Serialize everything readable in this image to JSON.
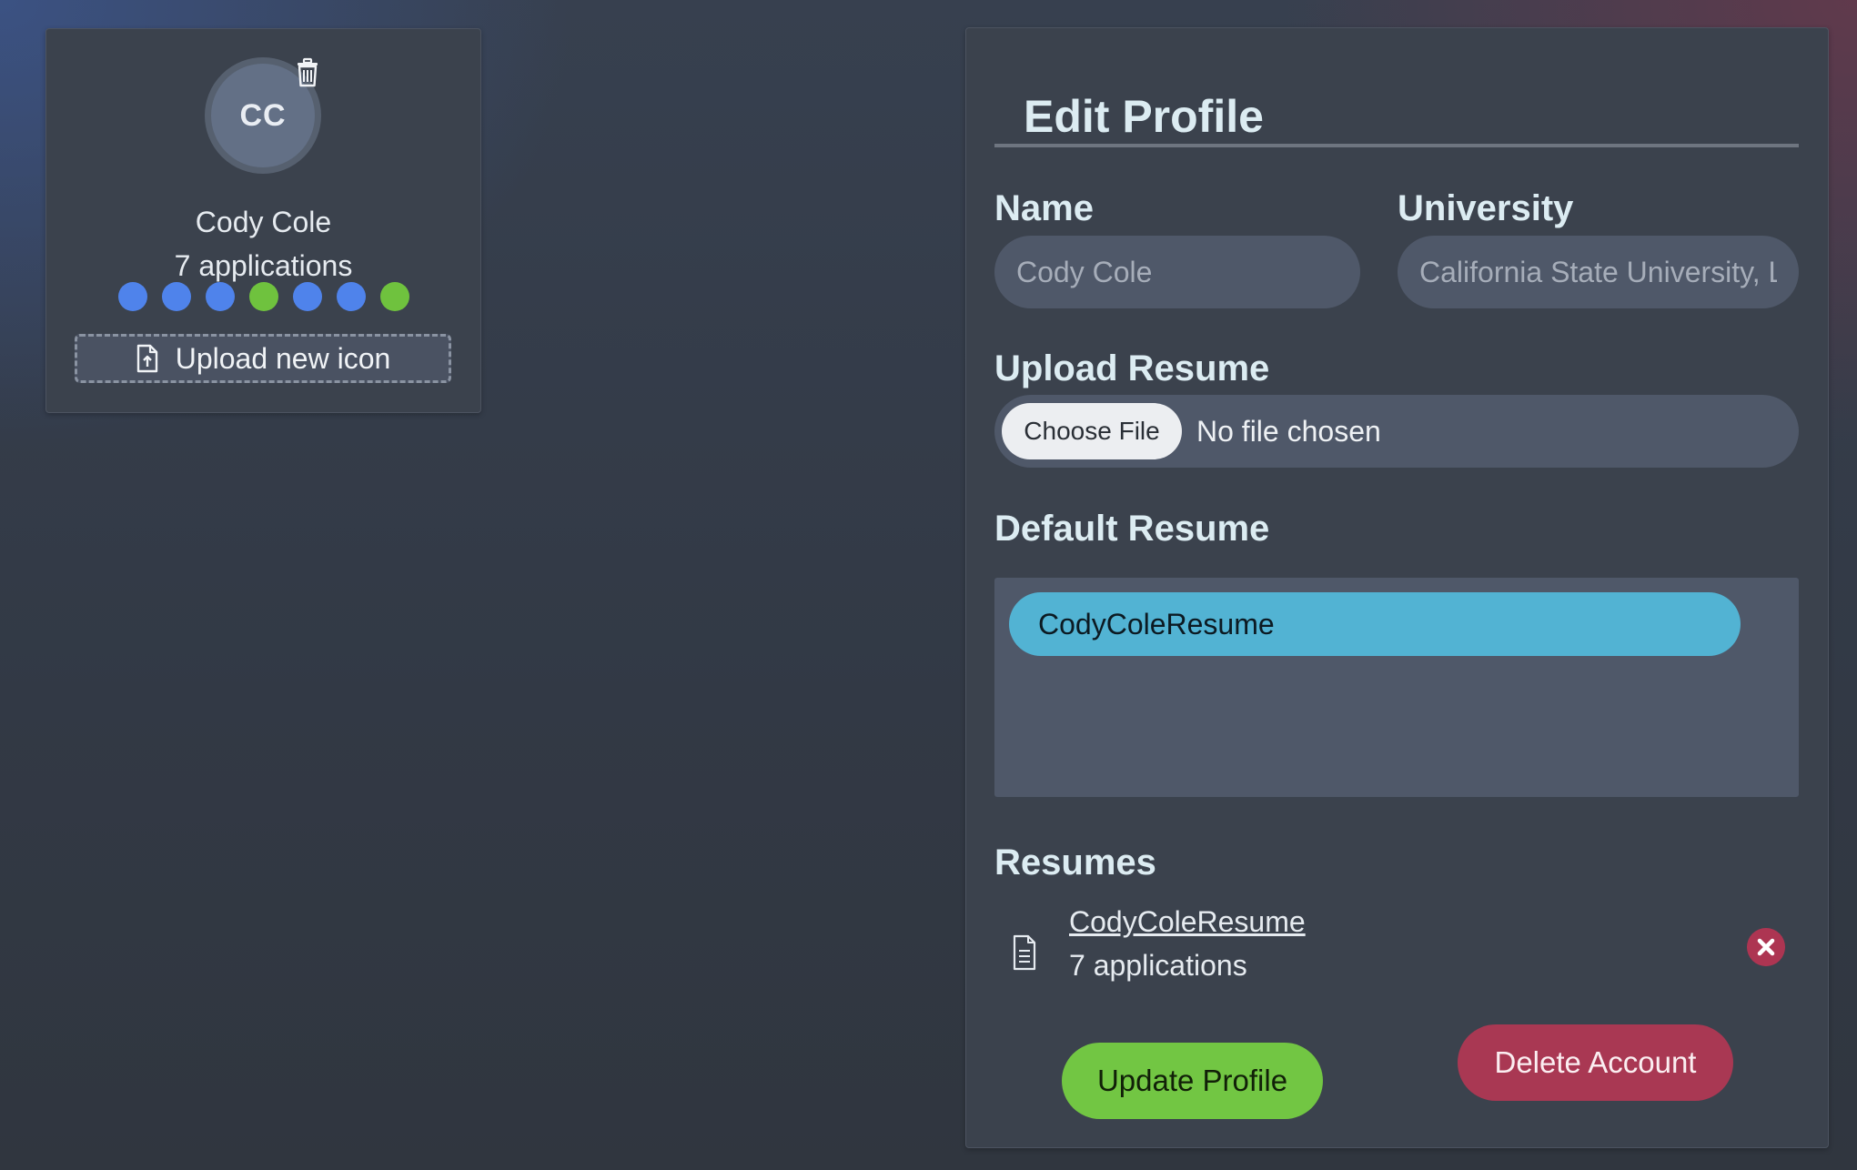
{
  "profile_card": {
    "avatar_initials": "CC",
    "name": "Cody Cole",
    "applications": "7 applications",
    "status_dots": [
      {
        "color": "#4f83eb"
      },
      {
        "color": "#4f83eb"
      },
      {
        "color": "#4f83eb"
      },
      {
        "color": "#6fc23e"
      },
      {
        "color": "#4f83eb"
      },
      {
        "color": "#4f83eb"
      },
      {
        "color": "#6fc23e"
      }
    ],
    "upload_button_label": "Upload new icon",
    "icons": {
      "delete": "trash-icon",
      "upload": "file-upload-icon"
    }
  },
  "edit_profile": {
    "title": "Edit Profile",
    "name_label": "Name",
    "name_placeholder": "Cody Cole",
    "university_label": "University",
    "university_placeholder": "California State University, Long Beach",
    "upload_resume_label": "Upload Resume",
    "choose_file_label": "Choose File",
    "no_file_text": "No file chosen",
    "default_resume_label": "Default Resume",
    "default_resume_options": [
      "CodyColeResume"
    ],
    "resumes_label": "Resumes",
    "resumes": [
      {
        "name": "CodyColeResume",
        "applications": "7 applications",
        "icon": "document-icon",
        "remove_icon": "remove-icon"
      }
    ],
    "update_button_label": "Update Profile",
    "delete_button_label": "Delete Account"
  },
  "colors": {
    "accent_blue": "#52b3d3",
    "success_green": "#72c643",
    "danger_red": "#a93853",
    "dot_blue": "#4f83eb",
    "dot_green": "#6fc23e"
  }
}
